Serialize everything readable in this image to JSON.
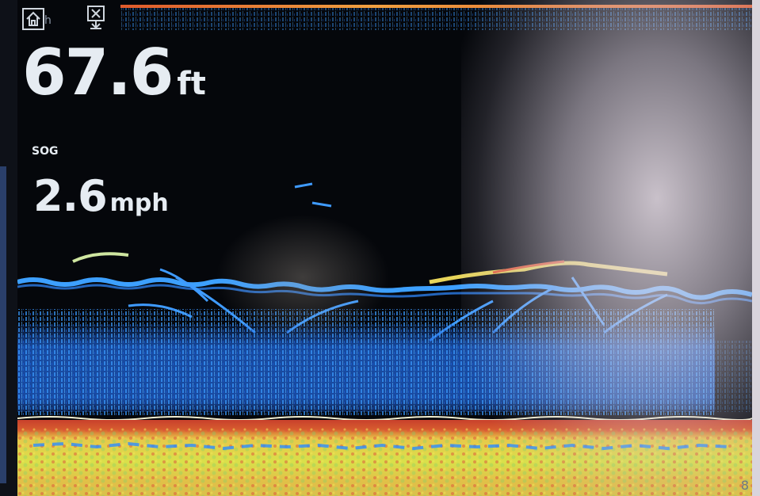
{
  "toolbar": {
    "home_suffix": "h"
  },
  "depth": {
    "value": "67.6",
    "unit": "ft"
  },
  "speed": {
    "label": "SOG",
    "value": "2.6",
    "unit": "mph"
  },
  "range_mark": "8",
  "colors": {
    "readout_text": "#e6ecf2",
    "sonar_return_blue": "#2a8cff",
    "bottom_red": "#c8412c",
    "bottom_yellow": "#d9e04a",
    "bottom_line": "#f2efd2"
  },
  "icons": [
    "home-icon",
    "waypoint-icon"
  ]
}
